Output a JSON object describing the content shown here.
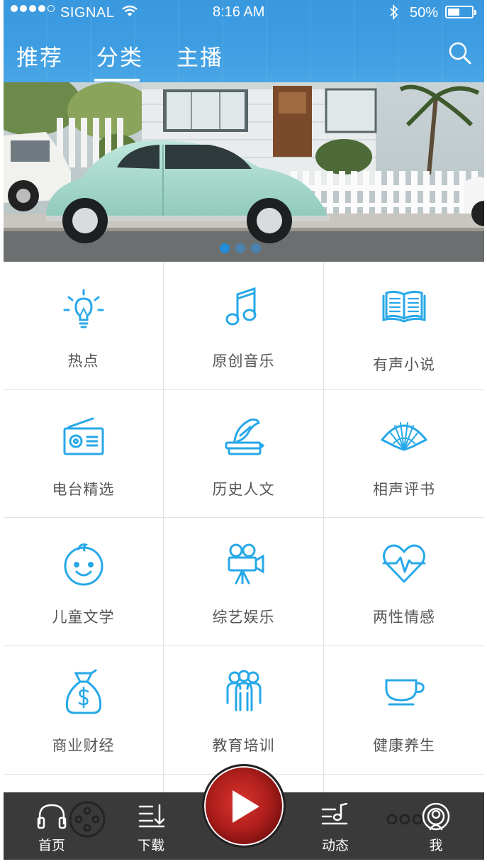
{
  "status": {
    "carrier": "SIGNAL",
    "time": "8:16 AM",
    "battery": "50%",
    "battery_level": 0.5
  },
  "nav": {
    "tabs": [
      "推荐",
      "分类",
      "主播"
    ],
    "active_tab": "分类"
  },
  "banner": {
    "page_count": 3,
    "active_page": 1
  },
  "categories": [
    {
      "label": "热点",
      "icon": "lightbulb-icon"
    },
    {
      "label": "原创音乐",
      "icon": "music-note-icon"
    },
    {
      "label": "有声小说",
      "icon": "open-book-icon"
    },
    {
      "label": "电台精选",
      "icon": "radio-icon"
    },
    {
      "label": "历史人文",
      "icon": "quill-books-icon"
    },
    {
      "label": "相声评书",
      "icon": "folding-fan-icon"
    },
    {
      "label": "儿童文学",
      "icon": "baby-face-icon"
    },
    {
      "label": "综艺娱乐",
      "icon": "movie-camera-icon"
    },
    {
      "label": "两性情感",
      "icon": "heart-pulse-icon"
    },
    {
      "label": "商业财经",
      "icon": "money-bag-icon"
    },
    {
      "label": "教育培训",
      "icon": "people-group-icon"
    },
    {
      "label": "健康养生",
      "icon": "tea-cup-icon"
    }
  ],
  "tabbar": {
    "items": [
      {
        "label": "首页",
        "icon": "headphones-icon"
      },
      {
        "label": "下载",
        "icon": "download-list-icon"
      },
      {
        "label": "动态",
        "icon": "music-list-icon"
      },
      {
        "label": "我",
        "icon": "podcast-user-icon"
      }
    ],
    "play_icon": "play-icon"
  },
  "colors": {
    "accent": "#27a8e8",
    "nav_bg": "#3f9ee2",
    "tabbar_bg": "#3a3a3a"
  }
}
